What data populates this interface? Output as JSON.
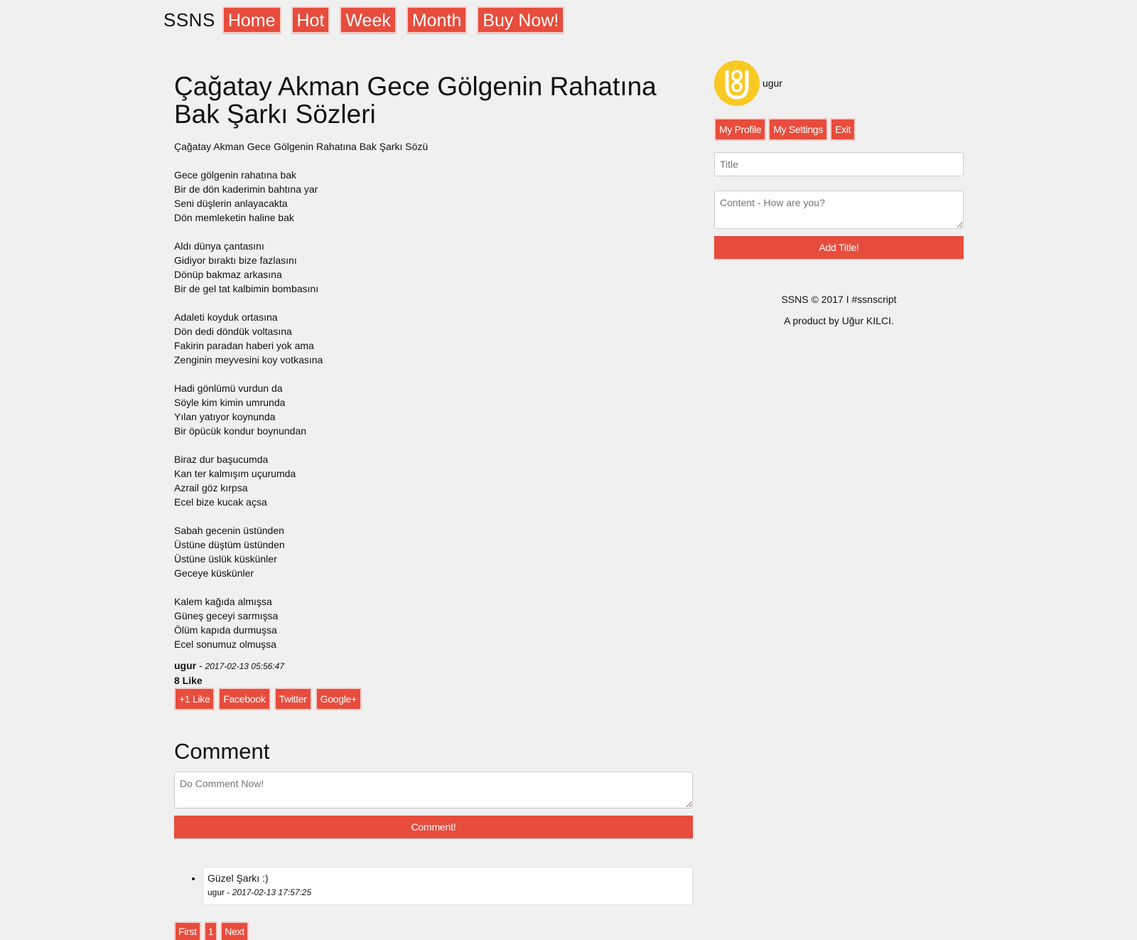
{
  "nav": {
    "brand": "SSNS",
    "items": [
      "Home",
      "Hot",
      "Week",
      "Month",
      "Buy Now!"
    ]
  },
  "post": {
    "title": "Çağatay Akman Gece Gölgenin Rahatına Bak Şarkı Sözleri",
    "body": "Çağatay Akman Gece Gölgenin Rahatına Bak Şarkı Sözü\n\nGece gölgenin rahatına bak\nBir de dön kaderimin bahtına yar\nSeni düşlerin anlayacakta\nDön memleketin haline bak\n\nAldı dünya çantasını\nGidiyor bıraktı bize fazlasını\nDönüp bakmaz arkasına\nBir de gel tat kalbimin bombasını\n\nAdaleti koyduk ortasına\nDön dedi döndük voltasına\nFakirin paradan haberi yok ama\nZenginin meyvesini koy votkasına\n\nHadi gönlümü vurdun da\nSöyle kim kimin umrunda\nYılan yatıyor koynunda\nBir öpücük kondur boynundan\n\nBiraz dur başucumda\nKan ter kalmışım uçurumda\nAzrail göz kırpsa\nEcel bize kucak açsa\n\nSabah gecenin üstünden\nÜstüne düştüm üstünden\nÜstüne üslük küskünler\nGeceye küskünler\n\nKalem kağıda almışsa\nGüneş geceyi sarmışsa\nÖlüm kapıda durmuşsa\nEcel sonumuz olmuşsa",
    "author": "ugur",
    "separator": " - ",
    "date": "2017-02-13 05:56:47",
    "likes": "8 Like",
    "actions": {
      "like": "+1 Like",
      "facebook": "Facebook",
      "twitter": "Twitter",
      "google": "Google+"
    }
  },
  "comment_form": {
    "heading": "Comment",
    "placeholder": "Do Comment Now!",
    "submit": "Comment!"
  },
  "comments": [
    {
      "text": "Güzel Şarkı :)",
      "author": "ugur",
      "separator": " - ",
      "date": "2017-02-13 17:57:25"
    }
  ],
  "pager": {
    "first": "First",
    "page": "1",
    "next": "Next"
  },
  "sidebar": {
    "username": "ugur",
    "buttons": {
      "profile": "My Profile",
      "settings": "My Settings",
      "exit": "Exit"
    },
    "title_placeholder": "Title",
    "content_placeholder": "Content - How are you?",
    "submit": "Add Title!",
    "footer_line1": "SSNS © 2017 I #ssnscript",
    "footer_line2": "A product by Uğur KILCI."
  },
  "colors": {
    "accent": "#e74c3c",
    "background": "#f0f0f0",
    "avatar": "#f9c923"
  },
  "icons": {
    "avatar": "user-avatar-logo"
  }
}
